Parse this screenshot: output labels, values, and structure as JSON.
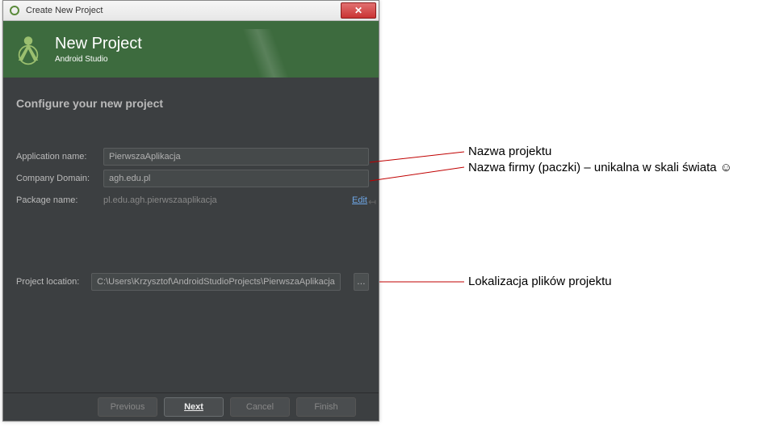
{
  "window": {
    "title": "Create New Project"
  },
  "header": {
    "title": "New Project",
    "subtitle": "Android Studio"
  },
  "section_title": "Configure your new project",
  "form": {
    "application_name": {
      "label": "Application name:",
      "value": "PierwszaAplikacja"
    },
    "company_domain": {
      "label": "Company Domain:",
      "value": "agh.edu.pl"
    },
    "package_name": {
      "label": "Package name:",
      "value": "pl.edu.agh.pierwszaaplikacja",
      "edit": "Edit"
    },
    "project_location": {
      "label": "Project location:",
      "value": "C:\\Users\\Krzysztof\\AndroidStudioProjects\\PierwszaAplikacja",
      "browse": "…"
    }
  },
  "buttons": {
    "previous": "Previous",
    "next": "Next",
    "cancel": "Cancel",
    "finish": "Finish"
  },
  "annotations": {
    "a1": "Nazwa projektu",
    "a2": "Nazwa firmy (paczki) – unikalna w skali świata ☺",
    "a3": "Lokalizacja plików projektu"
  }
}
